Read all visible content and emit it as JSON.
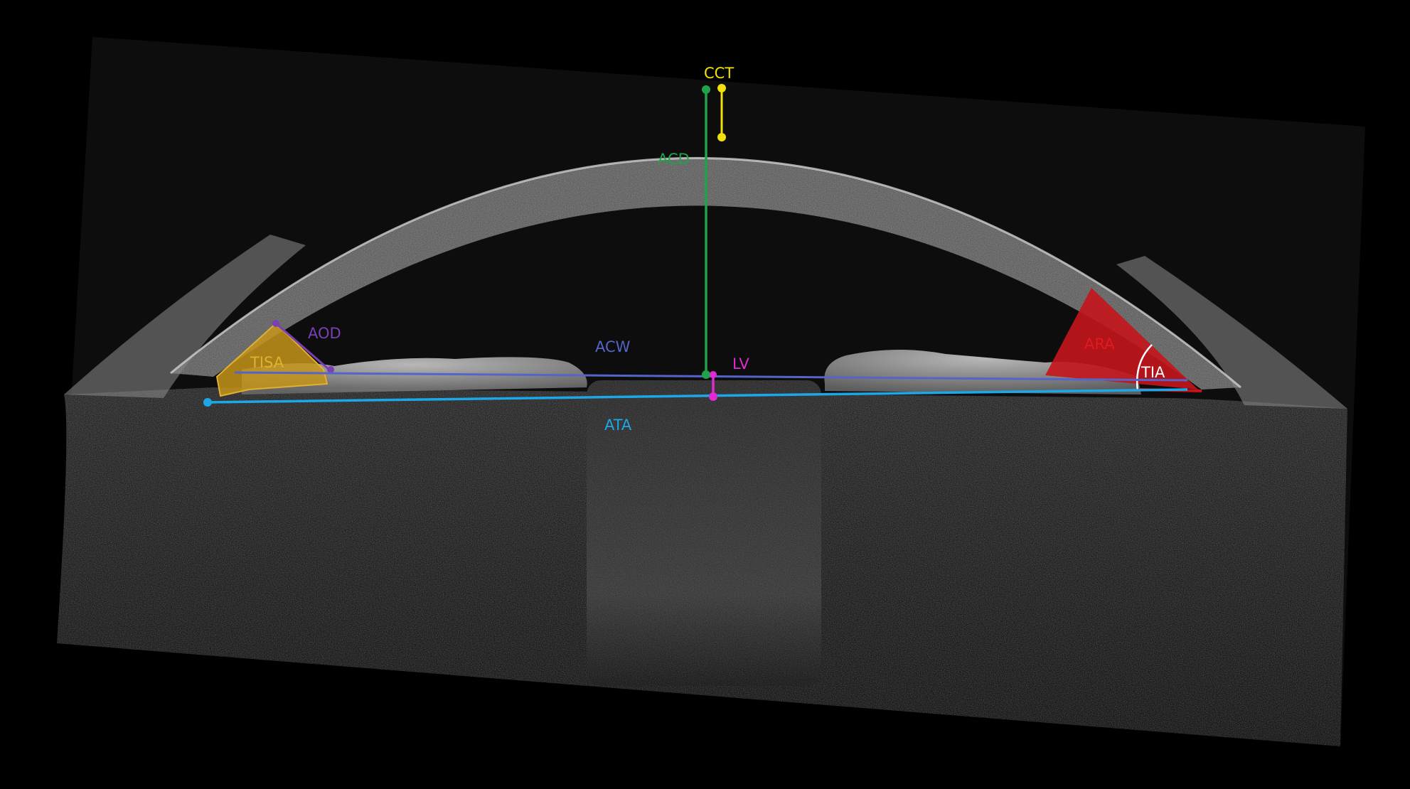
{
  "image": {
    "kind": "anterior segment OCT scan with measurement annotations",
    "background": "#000000"
  },
  "labels": {
    "cct": "CCT",
    "acd": "ACD",
    "aod": "AOD",
    "tisa": "TISA",
    "acw": "ACW",
    "lv": "LV",
    "ata": "ATA",
    "ara": "ARA",
    "tia": "TIA"
  },
  "colors": {
    "cct": "#f2e00a",
    "acd": "#1fa34a",
    "aod": "#7a3fb3",
    "tisa": "#c6951a",
    "acw": "#5564c8",
    "lv": "#e02ad2",
    "ata": "#1ea7e6",
    "ara": "#c4151c",
    "tia": "#ffffff"
  }
}
